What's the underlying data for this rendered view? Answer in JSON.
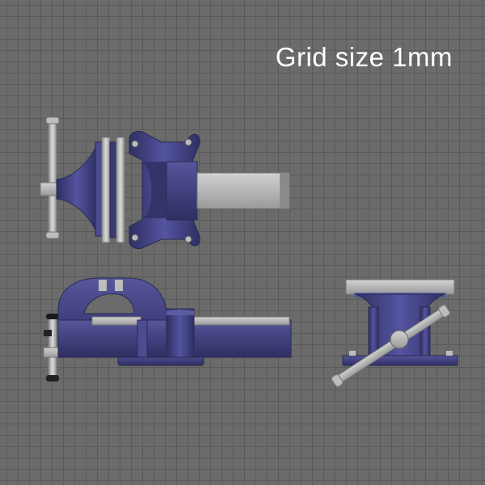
{
  "caption": "Grid size 1mm",
  "colors": {
    "background": "#6b6b6b",
    "grid_line": "#5a5a5a",
    "vise_body": "#3f3f7e",
    "vise_dark": "#2b2b5a",
    "vise_light": "#5a5a9e",
    "steel": "#a9a9a9",
    "steel_light": "#cfcfcf",
    "caption_text": "#ffffff"
  },
  "views": [
    "top-view",
    "side-view",
    "front-view"
  ]
}
